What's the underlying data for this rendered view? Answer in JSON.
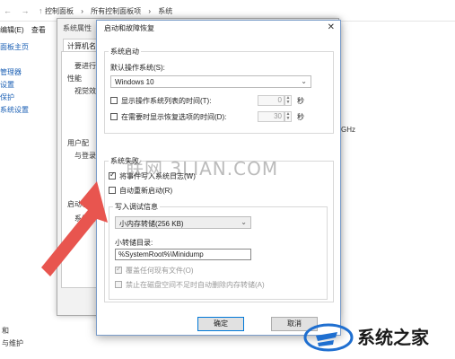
{
  "background": {
    "address_crumbs": [
      "控制面板",
      "所有控制面板项",
      "系统"
    ],
    "menu": [
      "编辑(E)",
      "查看"
    ],
    "side_items": [
      "面板主页",
      "",
      "管理器",
      "设置",
      "保护",
      "系统设置"
    ],
    "cpu_suffix": "GHz",
    "bottom_items": [
      "和",
      "与维护"
    ]
  },
  "sysprop": {
    "title": "系统属性",
    "tab": "计算机名",
    "texts": [
      "要进行",
      "性能",
      "视觉效",
      "用户配",
      "与登录",
      "启动和",
      "系统启"
    ]
  },
  "dialog": {
    "title": "启动和故障恢复",
    "close": "✕",
    "startup_group": {
      "label": "系统启动",
      "default_os_label": "默认操作系统(S):",
      "default_os_value": "Windows 10",
      "show_list_label": "显示操作系统列表的时间(T):",
      "show_list_value": "0",
      "show_recovery_label": "在需要时显示恢复选项的时间(D):",
      "show_recovery_value": "30",
      "seconds": "秒"
    },
    "failure_group": {
      "label": "系统失败",
      "write_event_label": "将事件写入系统日志(W)",
      "auto_restart_label": "自动重新启动(R)",
      "debug_group_label": "写入调试信息",
      "debug_value": "小内存转储(256 KB)",
      "dump_dir_label": "小转储目录:",
      "dump_dir_value": "%SystemRoot%\\Minidump",
      "overwrite_label": "覆盖任何现有文件(O)",
      "disable_auto_delete_label": "禁止在磁盘空间不足时自动删除内存转储(A)"
    },
    "ok_label": "确定",
    "cancel_label": "取消"
  },
  "watermarks": {
    "center": "联网 3LIAN.COM",
    "logo_text": "系统之家"
  },
  "colors": {
    "arrow": "#e8554f",
    "dialog_border": "#7a9cc9",
    "primary_border": "#0078d7",
    "logo_blue": "#1f6fd0"
  }
}
